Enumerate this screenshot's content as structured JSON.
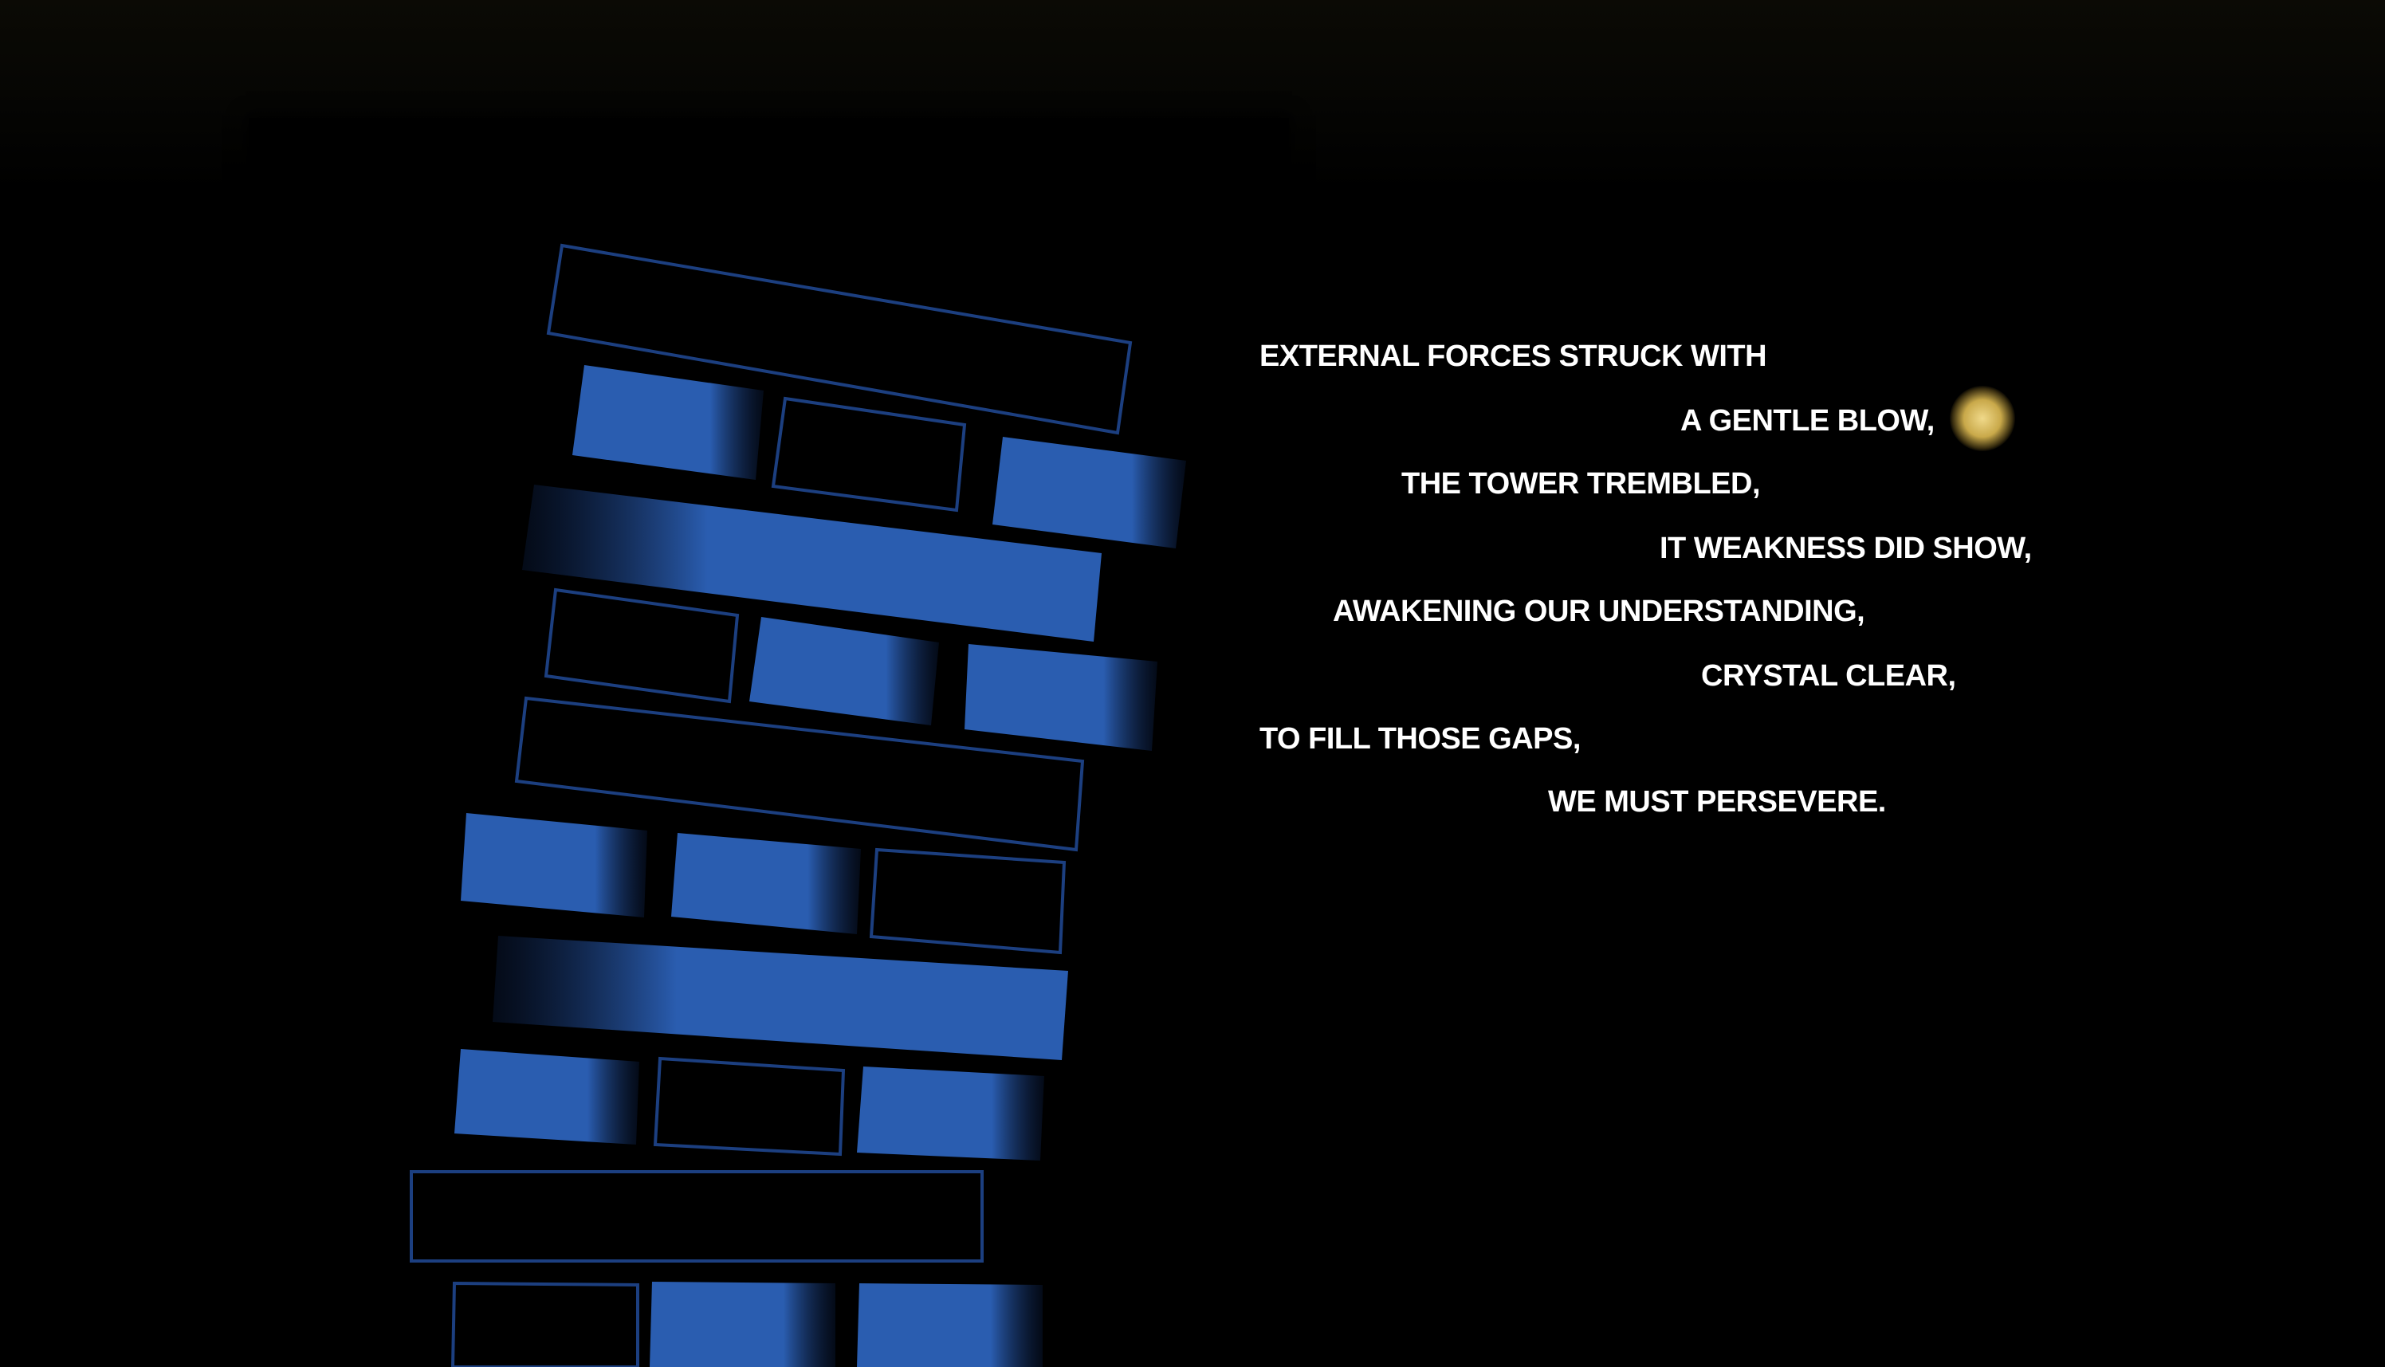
{
  "poem": {
    "lines": [
      "EXTERNAL FORCES STRUCK WITH",
      "A GENTLE BLOW,",
      "THE TOWER TREMBLED,",
      "IT WEAKNESS DID SHOW,",
      "AWAKENING OUR UNDERSTANDING,",
      "CRYSTAL CLEAR,",
      "TO FILL THOSE GAPS,",
      "WE MUST PERSEVERE."
    ]
  },
  "colors": {
    "background": "#000000",
    "block_fill": "#2a5db0",
    "block_outline": "#1c3f80",
    "text": "#ffffff",
    "glow": "#e8c96a"
  }
}
